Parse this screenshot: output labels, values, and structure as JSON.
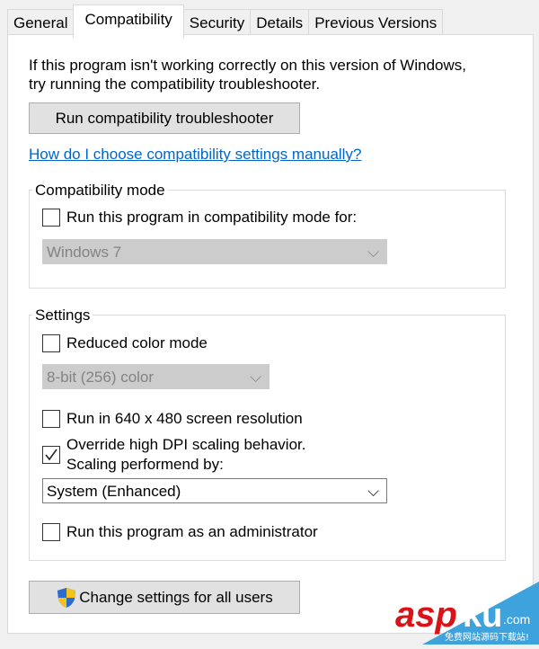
{
  "tabs": [
    {
      "label": "General"
    },
    {
      "label": "Compatibility"
    },
    {
      "label": "Security"
    },
    {
      "label": "Details"
    },
    {
      "label": "Previous Versions"
    }
  ],
  "active_tab": "Compatibility",
  "intro": {
    "line1": "If this program isn't working correctly on this version of Windows,",
    "line2": "try running the compatibility troubleshooter."
  },
  "troubleshooter_button": "Run compatibility troubleshooter",
  "manual_link": "How do I choose compatibility settings manually?",
  "compat_mode": {
    "title": "Compatibility mode",
    "checkbox_label": "Run this program in compatibility mode for:",
    "checked": false,
    "select_value": "Windows 7",
    "enabled": false
  },
  "settings": {
    "title": "Settings",
    "reduced_color": {
      "label": "Reduced color mode",
      "checked": false,
      "select_value": "8-bit (256) color"
    },
    "resolution": {
      "label": "Run in 640 x 480 screen resolution",
      "checked": false
    },
    "dpi": {
      "label_line1": "Override high DPI scaling behavior.",
      "label_line2": "Scaling performend by:",
      "checked": true,
      "select_value": "System (Enhanced)"
    },
    "admin": {
      "label": "Run this program as an administrator",
      "checked": false
    }
  },
  "change_all_button": "Change settings for all users",
  "watermark": {
    "brand": "aspku",
    "domain": ".com",
    "tagline": "免费网站源码下载站!"
  },
  "colors": {
    "link": "#0066cc",
    "button": "#e1e1e1",
    "watermark_red": "#d7141a",
    "watermark_blue": "#3ea3dc"
  }
}
